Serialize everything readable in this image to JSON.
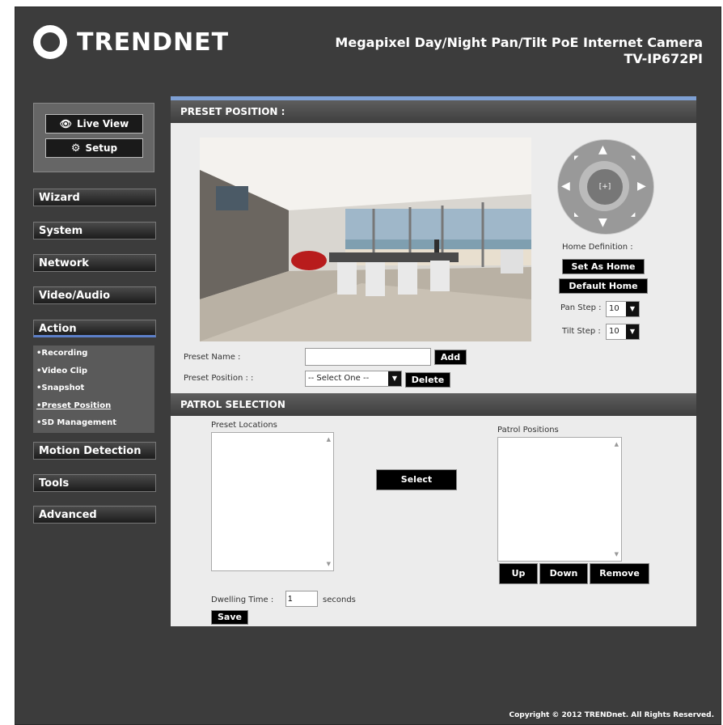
{
  "header": {
    "brand": "TRENDNET",
    "product_line1": "Megapixel Day/Night Pan/Tilt PoE Internet Camera",
    "product_line2": "TV-IP672PI"
  },
  "view_buttons": [
    {
      "label": "Live View",
      "icon": "eye-icon"
    },
    {
      "label": "Setup",
      "icon": "gear-icon"
    }
  ],
  "nav": {
    "wizard": "Wizard",
    "system": "System",
    "network": "Network",
    "video_audio": "Video/Audio",
    "action": "Action",
    "action_sub": [
      "•Recording",
      "•Video Clip",
      "•Snapshot",
      "•Preset Position",
      "•SD Management"
    ],
    "motion_detection": "Motion Detection",
    "tools": "Tools",
    "advanced": "Advanced"
  },
  "preset": {
    "header": "PRESET POSITION :",
    "home_definition": "Home Definition :",
    "set_as_home": "Set As Home",
    "default_home": "Default Home",
    "pan_step_label": "Pan Step :",
    "pan_step_value": "10",
    "tilt_step_label": "Tilt Step :",
    "tilt_step_value": "10",
    "preset_name_label": "Preset Name :",
    "preset_name_value": "",
    "add": "Add",
    "preset_position_label": "Preset Position : :",
    "preset_position_selected": "-- Select One --",
    "delete": "Delete",
    "ptz_center": "[+]"
  },
  "patrol": {
    "header": "PATROL SELECTION",
    "preset_locations": "Preset Locations",
    "patrol_positions": "Patrol Positions",
    "select": "Select",
    "up": "Up",
    "down": "Down",
    "remove": "Remove",
    "dwelling_label": "Dwelling Time :",
    "dwelling_value": "1",
    "dwelling_unit": "seconds",
    "save": "Save"
  },
  "footer": {
    "copyright": "Copyright © 2012 TRENDnet. All Rights Reserved."
  },
  "colors": {
    "frame": "#3c3c3c",
    "accent": "#7ea0d4",
    "content_bg": "#ececec"
  }
}
